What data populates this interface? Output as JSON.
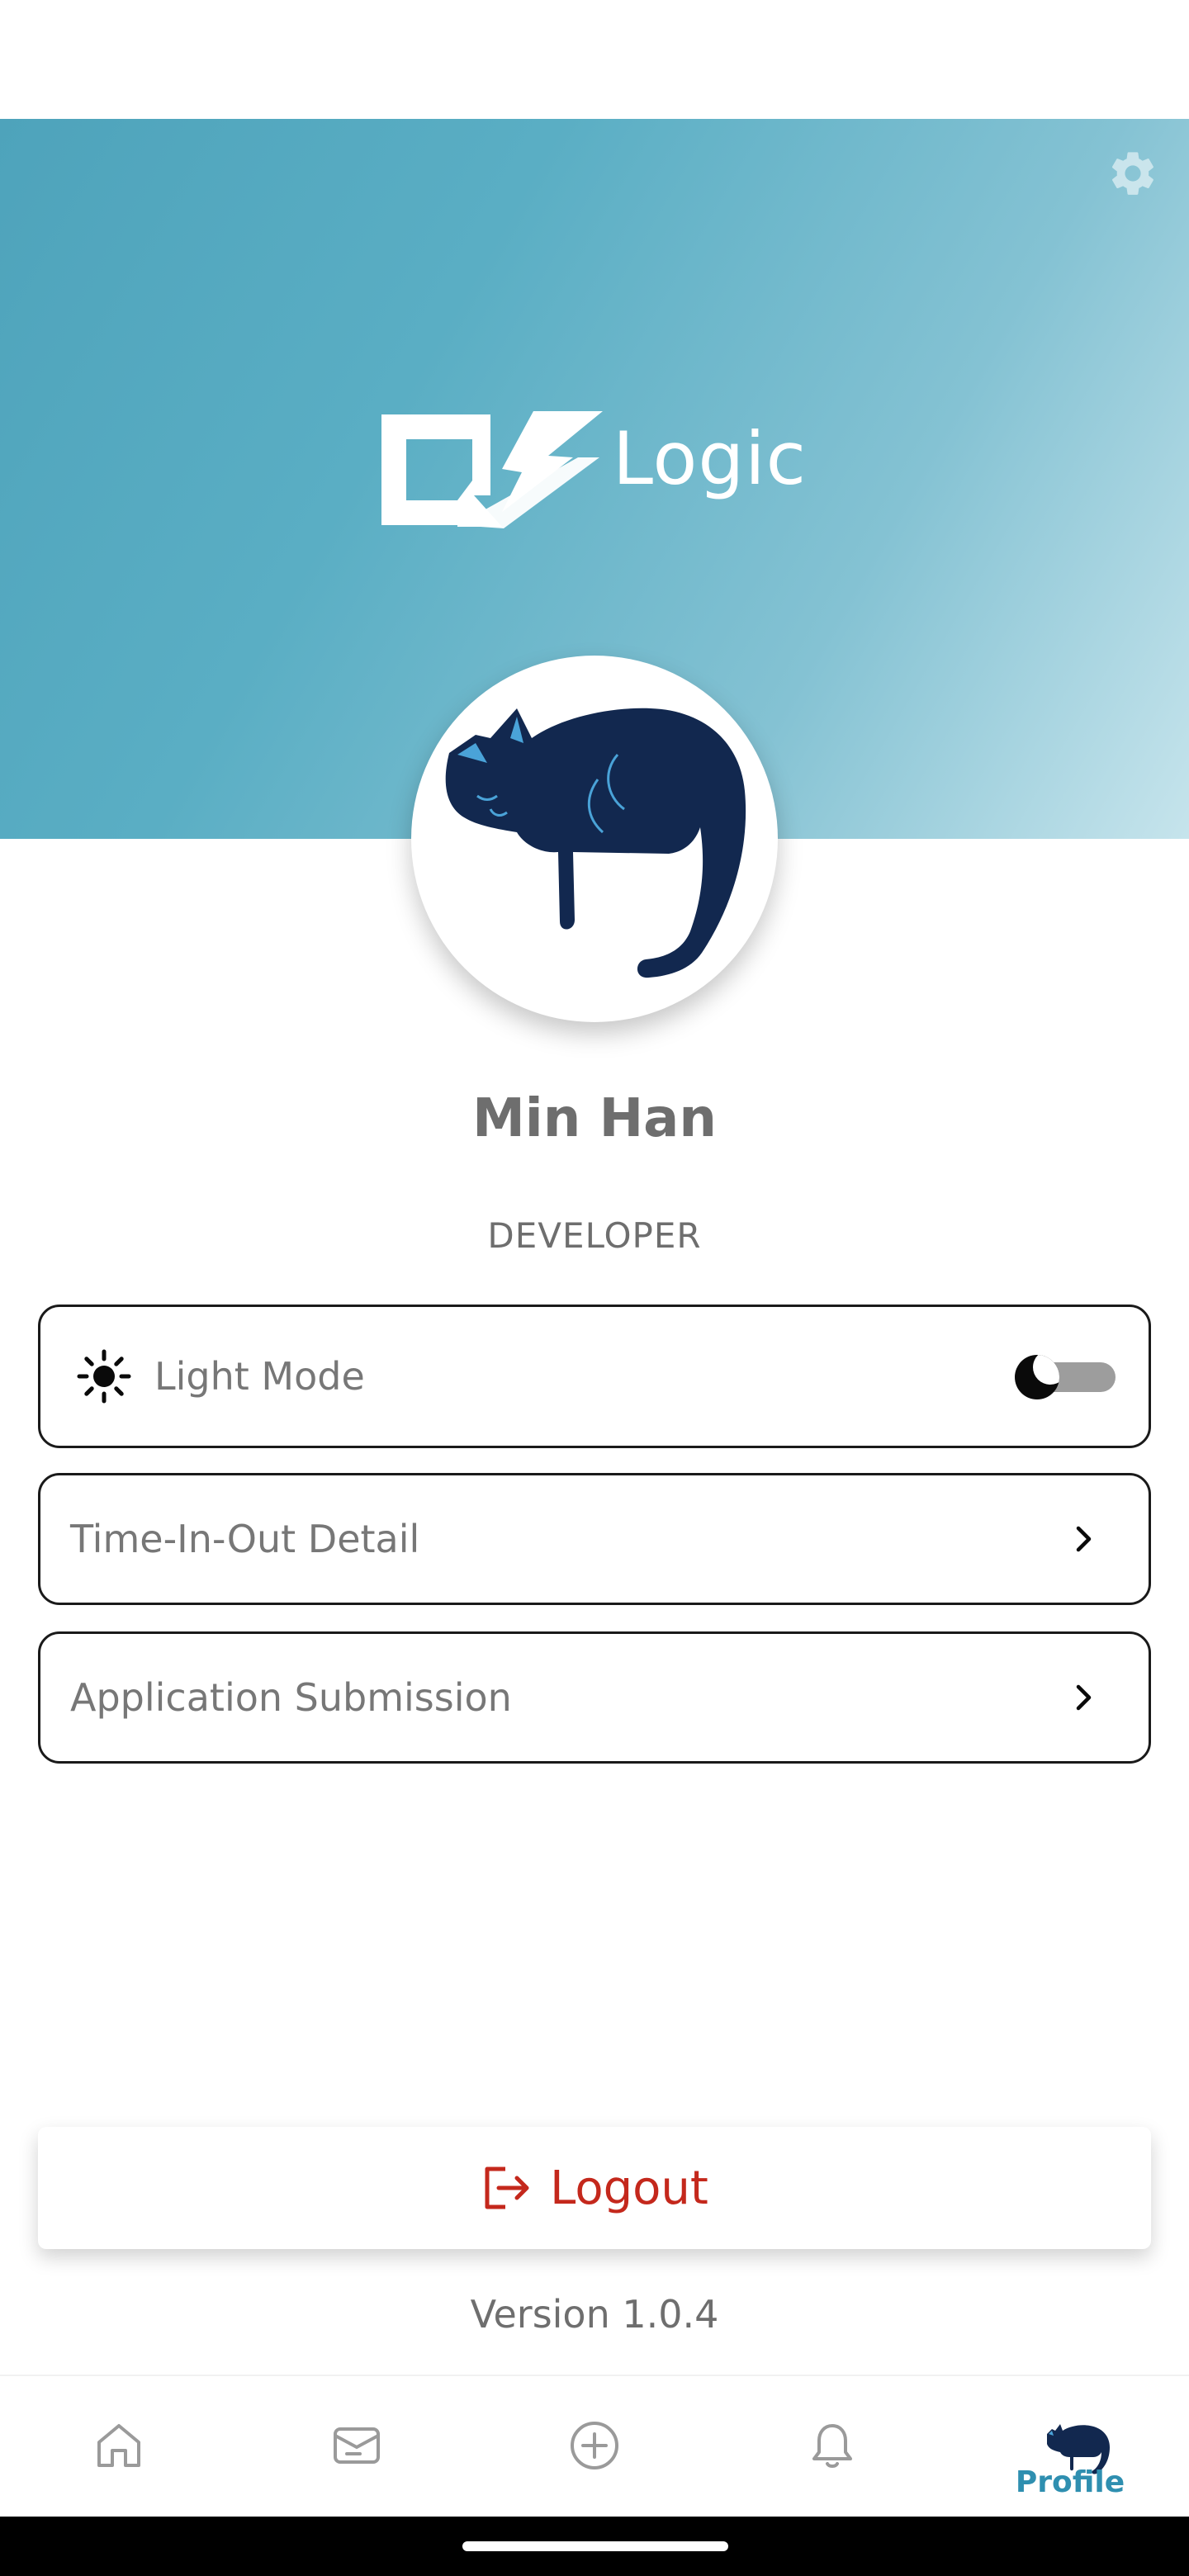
{
  "brand": {
    "name": "Logic"
  },
  "profile": {
    "name": "Min Han",
    "role": "DEVELOPER"
  },
  "settings": {
    "theme": {
      "label": "Light Mode",
      "dark_mode_enabled": false
    },
    "items": [
      {
        "label": "Time-In-Out Detail"
      },
      {
        "label": "Application Submission"
      }
    ]
  },
  "logout": {
    "label": "Logout"
  },
  "version": "Version 1.0.4",
  "bottom_nav": {
    "items": [
      "home-icon",
      "mail-icon",
      "add-icon",
      "bell-icon",
      "profile"
    ],
    "active_label": "Profile"
  },
  "colors": {
    "banner_start": "#4ea3bb",
    "banner_end": "#c6e4ec",
    "accent": "#2f8fb0",
    "logout": "#c4281c",
    "avatar_cat": "#12284f"
  }
}
